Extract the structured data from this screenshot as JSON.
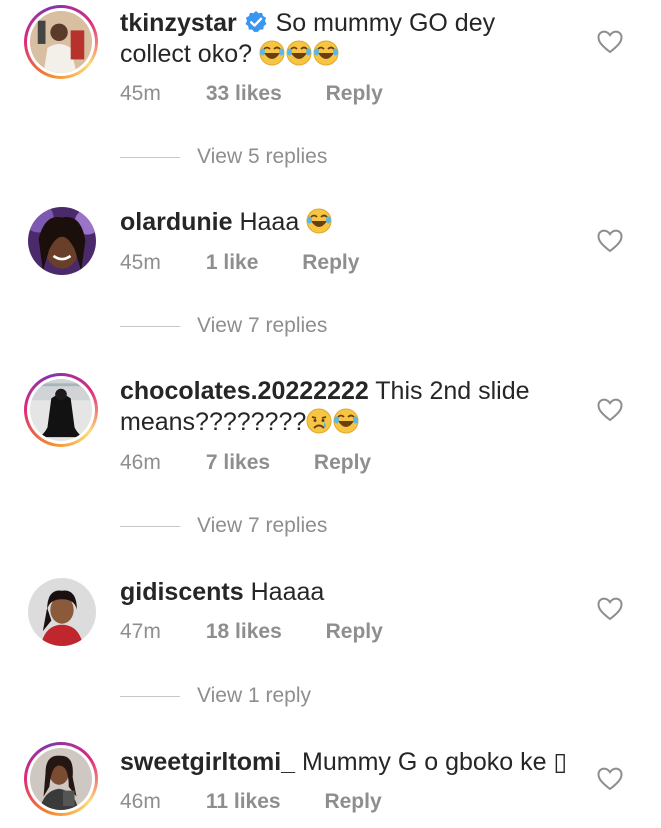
{
  "comments": [
    {
      "username": "tkinzystar",
      "verified": true,
      "text": "So mummy GO dey collect oko?",
      "emojis": [
        "laughing-emoji",
        "laughing-emoji",
        "laughing-emoji"
      ],
      "time": "45m",
      "likes": "33 likes",
      "reply_label": "Reply",
      "view_replies": "View 5 replies",
      "story_ring": true
    },
    {
      "username": "olardunie",
      "verified": false,
      "text": "Haaa",
      "emojis": [
        "laughing-emoji"
      ],
      "time": "45m",
      "likes": "1 like",
      "reply_label": "Reply",
      "view_replies": "View 7 replies",
      "story_ring": false
    },
    {
      "username": "chocolates.20222222",
      "verified": false,
      "text": "This 2nd slide means????????",
      "emojis": [
        "crying-emoji",
        "laughing-emoji"
      ],
      "time": "46m",
      "likes": "7 likes",
      "reply_label": "Reply",
      "view_replies": "View 7 replies",
      "story_ring": true
    },
    {
      "username": "gidiscents",
      "verified": false,
      "text": "Haaaa",
      "emojis": [],
      "time": "47m",
      "likes": "18 likes",
      "reply_label": "Reply",
      "view_replies": "View 1 reply",
      "story_ring": false
    },
    {
      "username": "sweetgirltomi_",
      "verified": false,
      "text": "Mummy G o gboko ke ▯",
      "emojis": [],
      "time": "46m",
      "likes": "11 likes",
      "reply_label": "Reply",
      "view_replies": "",
      "story_ring": true
    }
  ],
  "colors": {
    "text": "#262626",
    "secondary": "#8e8e8e",
    "verified": "#3897f0",
    "divider": "#c7c7c7"
  },
  "icons": {
    "like": "heart-outline-icon",
    "verified": "verified-badge-icon"
  }
}
